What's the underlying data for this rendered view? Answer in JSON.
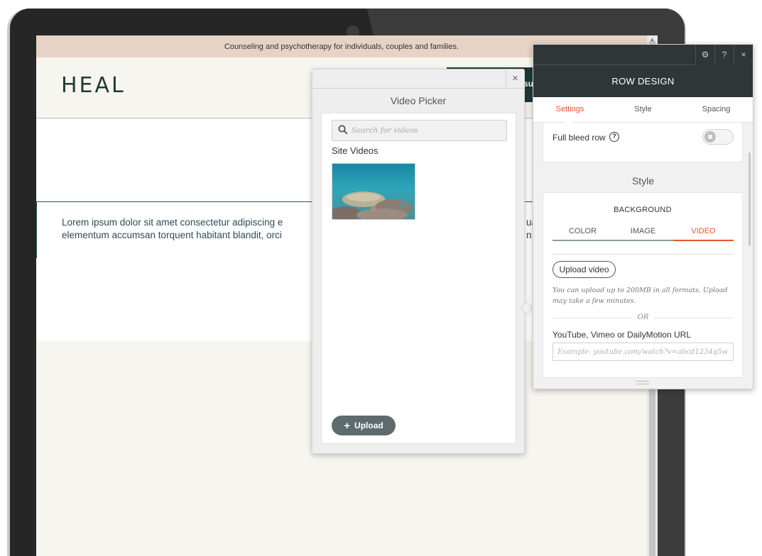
{
  "site": {
    "banner_text": "Counseling and psychotherapy for individuals, couples and families.",
    "logo_text": "HEAL",
    "header_cta_fragment": "su",
    "lorem_line1": "Lorem ipsum dolor sit amet consectetur adipiscing e",
    "lorem_line2": "elementum accumsan torquent habitant blandit, orci",
    "lorem_right1": "ua",
    "lorem_right2": "n f"
  },
  "video_picker": {
    "close_label": "×",
    "title": "Video Picker",
    "search_placeholder": "Search for videos",
    "section_label": "Site Videos",
    "videos": [
      {
        "name": "coral-reef-video"
      }
    ],
    "upload_label": "Upload",
    "upload_icon": "+"
  },
  "row_design": {
    "icons": {
      "settings": "⚙",
      "help": "?",
      "close": "×"
    },
    "title": "ROW DESIGN",
    "tabs": [
      {
        "label": "Settings",
        "active": true
      },
      {
        "label": "Style",
        "active": false
      },
      {
        "label": "Spacing",
        "active": false
      }
    ],
    "full_bleed_label": "Full bleed row",
    "full_bleed_help": "?",
    "full_bleed_enabled": false,
    "toggle_off_glyph": "✖",
    "style_heading": "Style",
    "background_label": "BACKGROUND",
    "bg_tabs": [
      {
        "label": "COLOR",
        "active": false
      },
      {
        "label": "IMAGE",
        "active": false
      },
      {
        "label": "VIDEO",
        "active": true
      }
    ],
    "upload_video_label": "Upload video",
    "upload_note": "You can upload up to 200MB in all formats. Upload may take a few minutes.",
    "or_text": "OR",
    "url_label": "YouTube, Vimeo or DailyMotion URL",
    "url_placeholder": "Example: youtube.com/watch?v=abcd1234q5w"
  },
  "colors": {
    "accent": "#e8542a",
    "panel_header": "#2f3638",
    "banner": "#e7d3c5",
    "page_bg": "#f7f5ef",
    "upload_button": "#5e6b6e"
  }
}
